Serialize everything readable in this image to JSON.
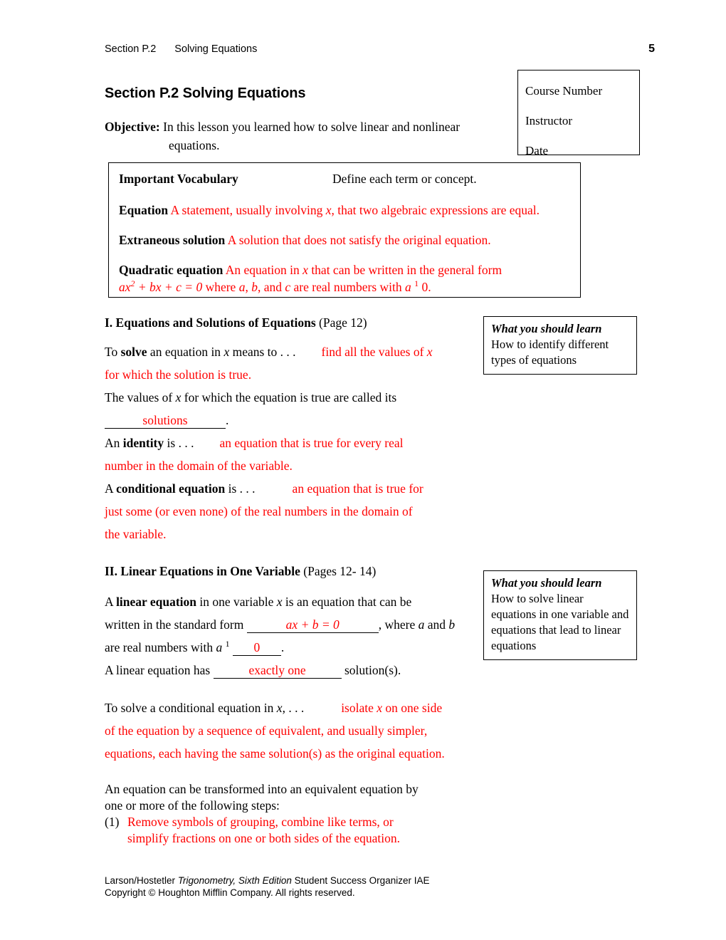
{
  "running_head": {
    "section": "Section P.2",
    "title": "Solving Equations",
    "page_number": "5"
  },
  "section_title": "Section P.2  Solving Equations",
  "objective": {
    "label": "Objective:",
    "line1": "In this lesson you learned how to solve linear and nonlinear",
    "line2": "equations."
  },
  "course_box": {
    "course_number": "Course Number",
    "instructor": "Instructor",
    "date": "Date"
  },
  "vocabulary": {
    "heading": "Important Vocabulary",
    "instruction": "Define each term or concept.",
    "entries": [
      {
        "term": "Equation",
        "def_pre": "A statement, usually involving ",
        "def_var": "x",
        "def_post": ", that two algebraic expressions are equal."
      },
      {
        "term": "Extraneous solution",
        "def_pre": "A solution that does not satisfy the original equation.",
        "def_var": "",
        "def_post": ""
      },
      {
        "term": "Quadratic equation",
        "def_pre": "An equation in ",
        "def_var": "x",
        "def_post": " that can be written in the general form"
      }
    ],
    "quadratic_formula": {
      "ax": "ax",
      "exp": "2",
      "rest": " + bx + c = 0",
      "where": " where ",
      "a": "a",
      "comma1": ", ",
      "b": "b",
      "and": ", and ",
      "c": "c",
      "are": " are real numbers with ",
      "a2": "a",
      "neq": "1",
      "zero": " 0."
    }
  },
  "section_I": {
    "heading": "I.  Equations and Solutions of Equations",
    "pages": "(Page 12)",
    "line1_pre": "To ",
    "line1_bold": "solve",
    "line1_mid": " an equation in ",
    "line1_var": "x",
    "line1_post": " means to . . .",
    "line1_answer_a": "find all the values of ",
    "line1_answer_var": "x",
    "line2_answer": "for which the solution is true.",
    "line3_pre": "The values of ",
    "line3_var": "x",
    "line3_post": " for which the equation is true are called its",
    "blank_solutions": "solutions",
    "blank_solutions_tail": ".",
    "identity_pre": "An ",
    "identity_bold": "identity",
    "identity_post": " is . . .",
    "identity_answer1": "an equation that is true for every real",
    "identity_answer2": "number in the domain of the variable.",
    "conditional_pre": "A ",
    "conditional_bold": "conditional equation",
    "conditional_post": " is . . .",
    "conditional_answer1": "an equation that is true for",
    "conditional_answer2": "just some (or even none) of the real numbers in the domain of",
    "conditional_answer3": "the variable."
  },
  "section_II": {
    "heading": "II.  Linear Equations in One Variable",
    "pages": "(Pages 12- 14)",
    "line1_pre": "A ",
    "line1_bold": "linear equation",
    "line1_mid": " in one variable ",
    "line1_var": "x",
    "line1_post": " is an equation that can be",
    "line2_pre": "written in the standard form",
    "blank_axb": "ax + b = 0",
    "line2_post_a": ", where ",
    "line2_var_a": "a",
    "line2_post_b": " and ",
    "line2_var_b": "b",
    "line3_pre": "are real numbers with ",
    "line3_var": "a",
    "line3_neq": "1",
    "blank_zero": "0",
    "line3_tail": ".",
    "line4_pre": "A linear equation has",
    "blank_one": "exactly one",
    "line4_post": "solution(s).",
    "solve_pre": "To solve a conditional equation in ",
    "solve_var": "x",
    "solve_post": ", . . .",
    "solve_answer1_a": "isolate ",
    "solve_answer1_var": "x",
    "solve_answer1_b": " on one side",
    "solve_answer2": "of the equation by a sequence of equivalent, and usually simpler,",
    "solve_answer3": "equations, each having the same solution(s) as the original equation.",
    "transform_line1": "An equation can be transformed into an equivalent equation by",
    "transform_line2": "one or more of the following steps:",
    "steps": [
      {
        "num": "(1)",
        "text_line1": "Remove symbols of grouping, combine like terms, or",
        "text_line2": "simplify fractions on one or both sides of the equation."
      }
    ]
  },
  "wysl_boxes": [
    {
      "title": "What you should learn",
      "text": "How to identify different types of equations"
    },
    {
      "title": "What you should learn",
      "text": "How to solve linear equations in one variable and equations that lead to linear equations"
    }
  ],
  "footer": {
    "line1_a": "Larson/Hostetler ",
    "line1_italic": "Trigonometry, Sixth Edition",
    "line1_b": " Student Success Organizer IAE",
    "line2": "Copyright © Houghton Mifflin Company. All rights reserved."
  },
  "colors": {
    "answer_red": "#FF0000",
    "text_black": "#000000",
    "border": "#000000"
  }
}
